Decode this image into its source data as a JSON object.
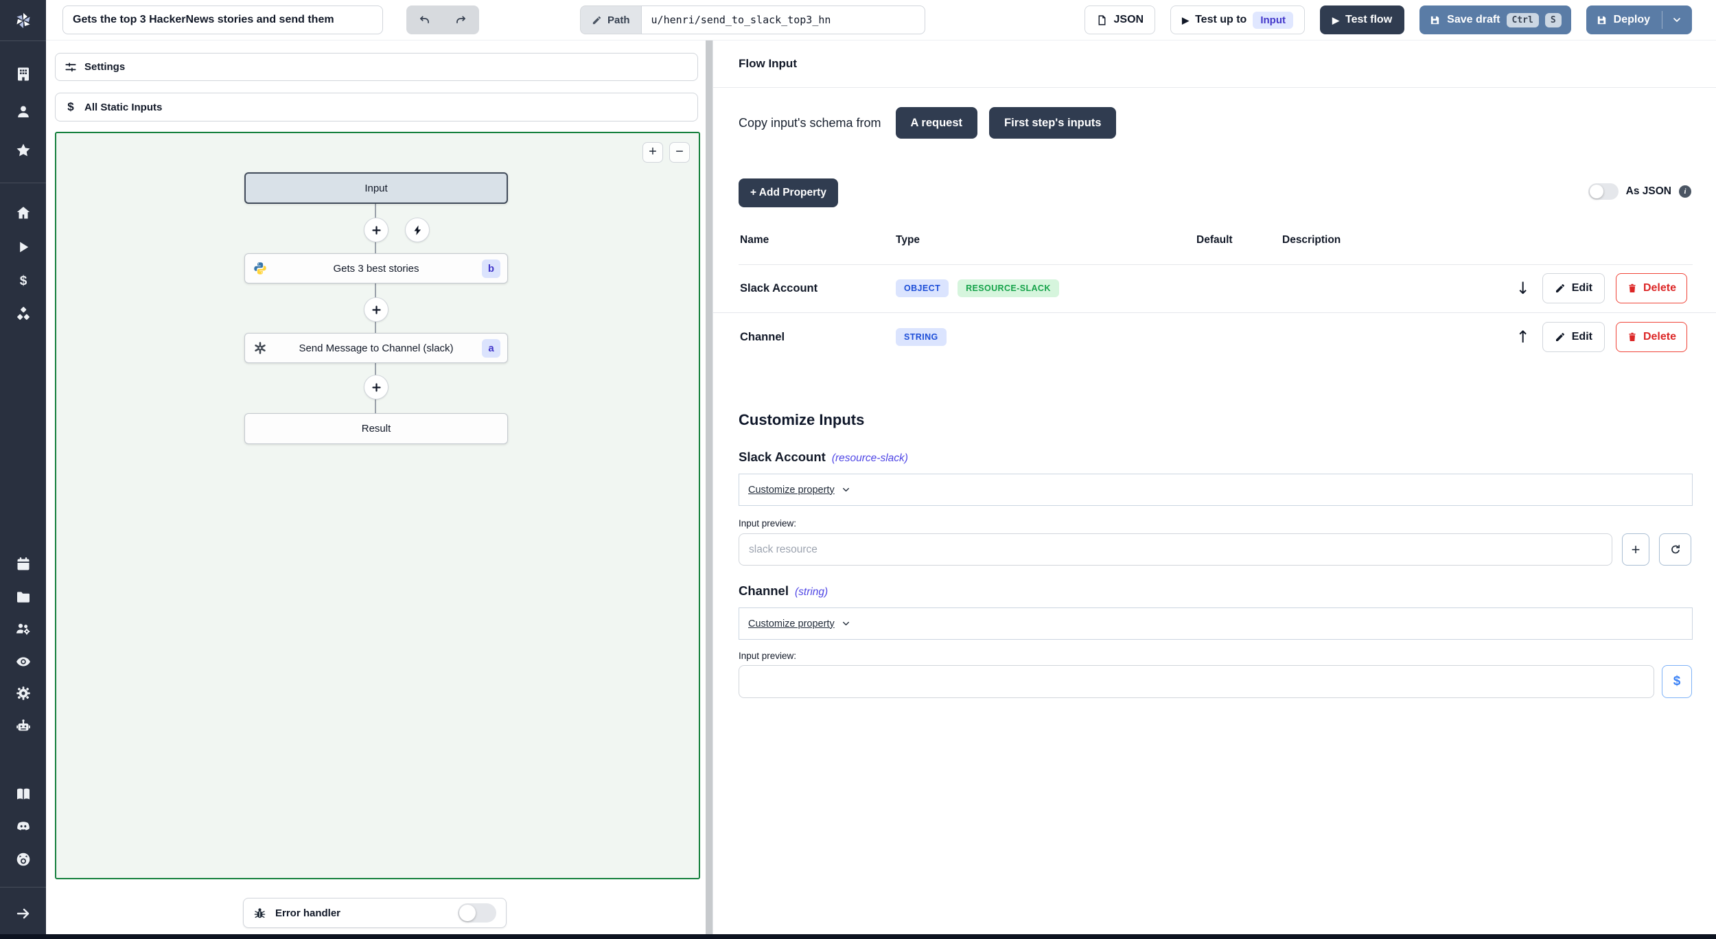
{
  "topbar": {
    "flow_title": "Gets the top 3 HackerNews stories and send them",
    "path_label": "Path",
    "path_value": "u/henri/send_to_slack_top3_hn",
    "json_label": "JSON",
    "test_up_to_label": "Test up to",
    "test_up_to_target": "Input",
    "test_flow_label": "Test flow",
    "save_draft_label": "Save draft",
    "shortcut_keys": [
      "Ctrl",
      "S"
    ],
    "deploy_label": "Deploy"
  },
  "sidebar": {
    "icon_names": [
      "workspace",
      "user",
      "favorites",
      "home",
      "runs",
      "variables",
      "resources",
      "schedules",
      "folders",
      "workers",
      "audit-logs",
      "settings",
      "ai",
      "docs",
      "discord",
      "github",
      "expand-sidebar"
    ]
  },
  "flow_panel": {
    "settings_label": "Settings",
    "static_inputs_label": "All Static Inputs",
    "zoom_in": "+",
    "zoom_out": "−",
    "nodes": {
      "input_label": "Input",
      "step_b_label": "Gets 3 best stories",
      "step_b_badge": "b",
      "step_a_label": "Send Message to Channel (slack)",
      "step_a_badge": "a",
      "result_label": "Result"
    },
    "error_handler_label": "Error handler"
  },
  "flow_input": {
    "title": "Flow Input",
    "copy_schema_label": "Copy input's schema from",
    "copy_buttons": [
      "A request",
      "First step's inputs"
    ],
    "add_property_label": "+ Add Property",
    "as_json_label": "As JSON",
    "table": {
      "headers": [
        "Name",
        "Type",
        "Default",
        "Description"
      ],
      "edit_label": "Edit",
      "delete_label": "Delete",
      "rows": [
        {
          "name": "Slack Account",
          "badges": [
            "OBJECT",
            "RESOURCE-SLACK"
          ],
          "move": "down"
        },
        {
          "name": "Channel",
          "badges": [
            "STRING"
          ],
          "move": "up"
        }
      ]
    },
    "customize": {
      "title": "Customize Inputs",
      "fields": [
        {
          "name": "Slack Account",
          "type_hint": "(resource-slack)",
          "dropdown_label": "Customize property",
          "preview_label": "Input preview:",
          "placeholder": "slack resource"
        },
        {
          "name": "Channel",
          "type_hint": "(string)",
          "dropdown_label": "Customize property",
          "preview_label": "Input preview:",
          "placeholder": ""
        }
      ]
    }
  },
  "glyphs": {
    "play": "▶",
    "arrow_down": "↓",
    "arrow_up": "↑",
    "dollar": "$",
    "info": "i"
  },
  "colors": {
    "accent_dark": "#303c50",
    "accent_slate": "#5a7ca6",
    "canvas_border": "#15803d",
    "badge_blue_text": "#1d4ed8",
    "badge_green_text": "#16a34a",
    "indigo_hint": "#4f46e5",
    "danger": "#dc2626",
    "sidebar_bg": "#29303f"
  }
}
